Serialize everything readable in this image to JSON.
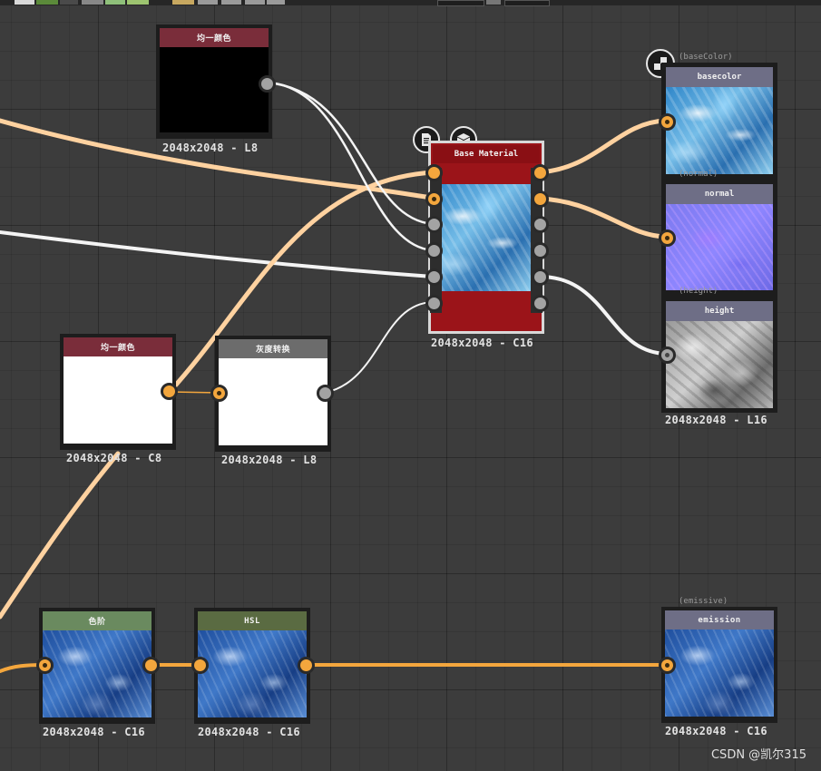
{
  "colors": {
    "canvas": "#3c3c3c",
    "wire_color": "#ffd2a0",
    "wire_orange": "#f3a63d",
    "wire_white": "#f4f4f4",
    "header_uniform": "#7a2d3a",
    "header_grayscale": "#6c6c6c",
    "header_levels": "#6a8a5f",
    "header_hsl": "#5a6b42",
    "header_output": "#6e6e86",
    "material_red": "#9b1419"
  },
  "nodes": {
    "uniform_black": {
      "title": "均一颜色",
      "caption": "2048x2048 - L8"
    },
    "base_material": {
      "title": "Base Material",
      "caption": "2048x2048 - C16",
      "icon_doc": "document-icon",
      "icon_cube": "cube-icon"
    },
    "uniform_white": {
      "title": "均一颜色",
      "caption": "2048x2048 - C8"
    },
    "grayscale": {
      "title": "灰度转换",
      "caption": "2048x2048 - L8"
    },
    "levels": {
      "title": "色阶",
      "caption": "2048x2048 - C16"
    },
    "hsl": {
      "title": "HSL",
      "caption": "2048x2048 - C16"
    },
    "out_basecolor": {
      "tag": "(baseColor)",
      "title": "basecolor",
      "icon": "checker-icon"
    },
    "out_normal": {
      "tag": "(normal)",
      "title": "normal"
    },
    "out_height": {
      "tag": "(height)",
      "title": "height",
      "caption": "2048x2048 - L16"
    },
    "out_emission": {
      "tag": "(emissive)",
      "title": "emission",
      "caption": "2048x2048 - C16"
    }
  },
  "watermark": "CSDN @凯尔315"
}
